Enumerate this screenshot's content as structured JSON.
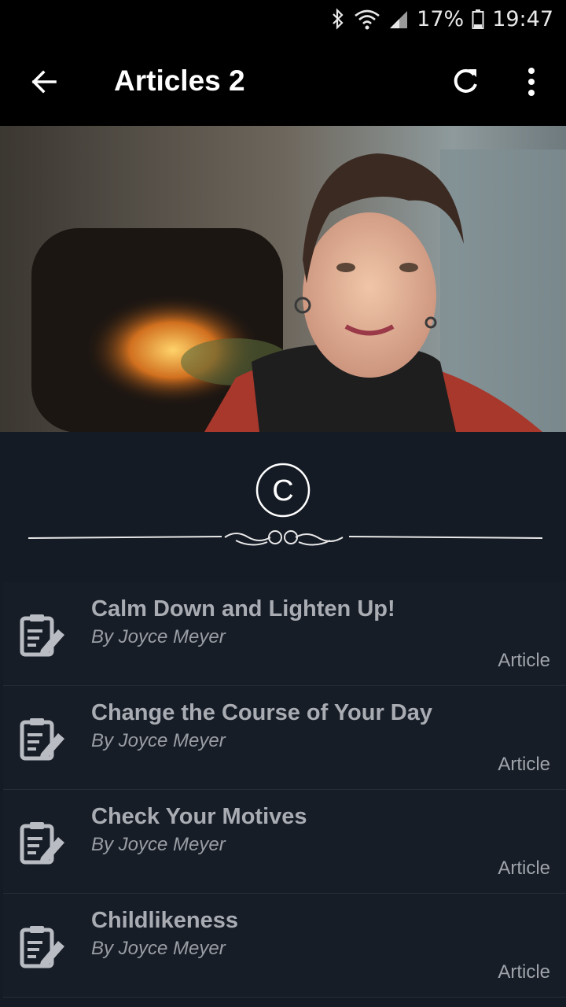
{
  "status": {
    "battery": "17%",
    "time": "19:47"
  },
  "appbar": {
    "title": "Articles 2"
  },
  "emblem": {
    "letter": "C"
  },
  "articles": [
    {
      "title": "Calm Down and Lighten Up!",
      "author": "By Joyce Meyer",
      "type": "Article"
    },
    {
      "title": "Change the Course of Your Day",
      "author": "By Joyce Meyer",
      "type": "Article"
    },
    {
      "title": "Check Your Motives",
      "author": "By Joyce Meyer",
      "type": "Article"
    },
    {
      "title": "Childlikeness",
      "author": "By Joyce Meyer",
      "type": "Article"
    }
  ],
  "icons": {
    "back": "arrow-left-icon",
    "refresh": "refresh-icon",
    "menu": "more-vert-icon",
    "article": "article-edit-icon"
  },
  "colors": {
    "background": "#151b25",
    "appbar": "#000000",
    "title_text": "#a9adb3"
  }
}
